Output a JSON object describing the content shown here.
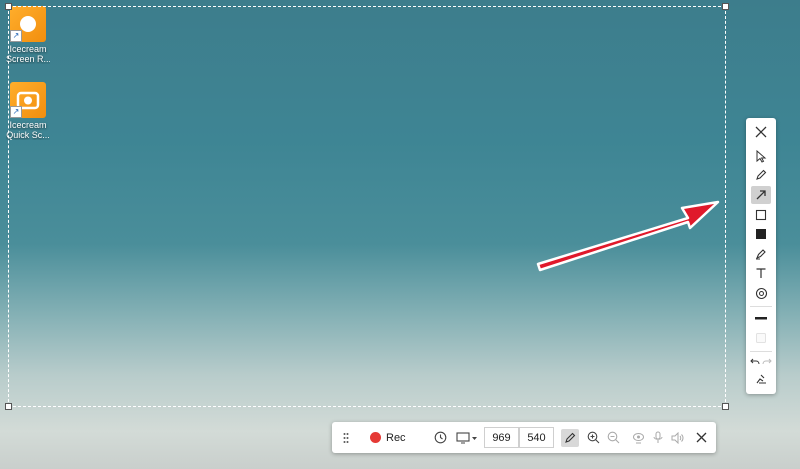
{
  "desktop": {
    "icons": [
      {
        "label_line1": "Icecream",
        "label_line2": "Screen R..."
      },
      {
        "label_line1": "Icecream",
        "label_line2": "Quick Sc..."
      }
    ]
  },
  "toolbar_bottom": {
    "rec_label": "Rec",
    "width_value": "969",
    "height_value": "540"
  },
  "colors": {
    "accent_red": "#e53935",
    "arrow_red": "#e0192b"
  },
  "icons": {
    "annotation_tools": [
      "close-icon",
      "select-cursor-icon",
      "pencil-icon",
      "arrow-tool-icon",
      "rectangle-outline-icon",
      "rectangle-filled-icon",
      "marker-icon",
      "text-icon",
      "numbering-icon",
      "line-thickness-icon",
      "color-swatch-icon",
      "undo-icon",
      "redo-icon",
      "clear-icon"
    ]
  }
}
